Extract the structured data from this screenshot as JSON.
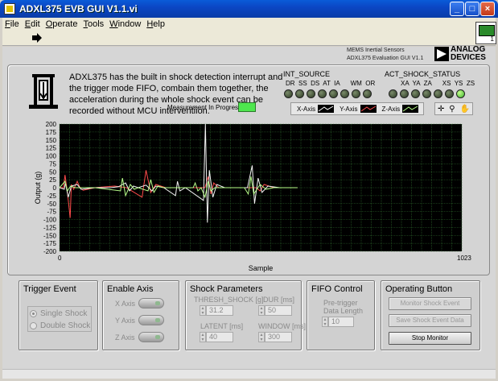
{
  "window": {
    "title": "ADXL375 EVB GUI V1.1.vi"
  },
  "menu": [
    {
      "key": "F",
      "rest": "ile"
    },
    {
      "key": "E",
      "rest": "dit"
    },
    {
      "key": "O",
      "rest": "perate"
    },
    {
      "key": "T",
      "rest": "ools"
    },
    {
      "key": "W",
      "rest": "indow"
    },
    {
      "key": "H",
      "rest": "elp"
    }
  ],
  "toolbar": {
    "vi_icon_label": "1"
  },
  "brand": {
    "line1": "MEMS Inertial Sensors",
    "line2": "ADXL375 Evaluation GUI V1.1",
    "logo_line1": "ANALOG",
    "logo_line2": "DEVICES"
  },
  "description": "ADXL375 has the built in shock detection interrupt and the trigger mode FIFO, combain them together, the acceleration during the whole shock event can be recorded without MCU interventiion.",
  "measurement": {
    "label": "Measurement In Progress",
    "led_color": "#4ee64e"
  },
  "int_source": {
    "title": "INT_SOURCE",
    "labels": "DR  SS  DS  AT  IA      WM  OR",
    "leds": [
      false,
      false,
      false,
      false,
      false,
      false,
      false,
      false
    ]
  },
  "act_shock_status": {
    "title": "ACT_SHOCK_STATUS",
    "labels": "XA  YA  ZA      XS  YS  ZS",
    "leds": [
      false,
      false,
      false,
      false,
      false,
      false,
      true
    ]
  },
  "legend": {
    "x": "X-Axis",
    "y": "Y-Axis",
    "z": "Z-Axis"
  },
  "chart_data": {
    "type": "line",
    "xlabel": "Sample",
    "ylabel": "Output (g)",
    "xlim": [
      0,
      1023
    ],
    "ylim": [
      -200,
      200
    ],
    "x_ticks": [
      "0",
      "1023"
    ],
    "y_ticks": [
      "200",
      "175",
      "150",
      "125",
      "100",
      "75",
      "50",
      "25",
      "0",
      "-25",
      "-50",
      "-75",
      "-100",
      "-125",
      "-150",
      "-175",
      "-200"
    ],
    "grid": true,
    "background": "#000000",
    "grid_color": "#2f6e2f",
    "series": [
      {
        "color": "#ff4a4a",
        "points": [
          [
            0,
            0
          ],
          [
            10,
            0
          ],
          [
            14,
            40
          ],
          [
            20,
            -15
          ],
          [
            27,
            -95
          ],
          [
            30,
            10
          ],
          [
            36,
            -5
          ],
          [
            45,
            20
          ],
          [
            52,
            0
          ],
          [
            60,
            -8
          ],
          [
            90,
            0
          ],
          [
            140,
            5
          ],
          [
            170,
            0
          ],
          [
            210,
            -30
          ],
          [
            220,
            55
          ],
          [
            232,
            -15
          ],
          [
            245,
            10
          ],
          [
            270,
            0
          ],
          [
            370,
            0
          ],
          [
            378,
            35
          ],
          [
            385,
            -20
          ],
          [
            392,
            15
          ],
          [
            405,
            0
          ],
          [
            500,
            0
          ],
          [
            510,
            -10
          ],
          [
            520,
            10
          ],
          [
            545,
            0
          ],
          [
            560,
            0
          ],
          [
            605,
            0
          ]
        ]
      },
      {
        "color": "#f4f4f4",
        "points": [
          [
            0,
            0
          ],
          [
            12,
            -5
          ],
          [
            15,
            15
          ],
          [
            22,
            -30
          ],
          [
            30,
            5
          ],
          [
            45,
            10
          ],
          [
            55,
            -5
          ],
          [
            90,
            0
          ],
          [
            130,
            0
          ],
          [
            150,
            3
          ],
          [
            168,
            15
          ],
          [
            178,
            -10
          ],
          [
            188,
            5
          ],
          [
            200,
            0
          ],
          [
            220,
            8
          ],
          [
            235,
            -10
          ],
          [
            245,
            5
          ],
          [
            265,
            0
          ],
          [
            295,
            -25
          ],
          [
            300,
            20
          ],
          [
            306,
            -10
          ],
          [
            320,
            0
          ],
          [
            366,
            -40
          ],
          [
            371,
            200
          ],
          [
            376,
            -110
          ],
          [
            381,
            55
          ],
          [
            390,
            -30
          ],
          [
            400,
            10
          ],
          [
            420,
            0
          ],
          [
            478,
            0
          ],
          [
            490,
            70
          ],
          [
            496,
            -50
          ],
          [
            505,
            30
          ],
          [
            515,
            -15
          ],
          [
            530,
            5
          ],
          [
            560,
            0
          ],
          [
            605,
            0
          ]
        ]
      },
      {
        "color": "#b8ff8a",
        "points": [
          [
            0,
            0
          ],
          [
            14,
            20
          ],
          [
            20,
            -10
          ],
          [
            28,
            5
          ],
          [
            40,
            0
          ],
          [
            90,
            0
          ],
          [
            155,
            -10
          ],
          [
            160,
            30
          ],
          [
            168,
            -25
          ],
          [
            180,
            10
          ],
          [
            190,
            -5
          ],
          [
            200,
            0
          ],
          [
            225,
            -10
          ],
          [
            232,
            25
          ],
          [
            240,
            -15
          ],
          [
            250,
            5
          ],
          [
            265,
            0
          ],
          [
            340,
            0
          ],
          [
            345,
            15
          ],
          [
            352,
            -10
          ],
          [
            360,
            0
          ],
          [
            370,
            -30
          ],
          [
            378,
            20
          ],
          [
            385,
            -10
          ],
          [
            395,
            0
          ],
          [
            470,
            0
          ],
          [
            480,
            -20
          ],
          [
            487,
            35
          ],
          [
            494,
            -20
          ],
          [
            510,
            10
          ],
          [
            525,
            -5
          ],
          [
            545,
            0
          ],
          [
            605,
            0
          ]
        ]
      }
    ]
  },
  "trigger_event": {
    "title": "Trigger Event",
    "single": "Single Shock",
    "double": "Double Shock"
  },
  "enable_axis": {
    "title": "Enable Axis",
    "x": "X Axis",
    "y": "Y Axis",
    "z": "Z Axis"
  },
  "shock_params": {
    "title": "Shock Parameters",
    "thresh_label": "THRESH_SHOCK [g]",
    "thresh_value": "31.2",
    "dur_label": "DUR [ms]",
    "dur_value": "50",
    "latent_label": "LATENT [ms]",
    "latent_value": "40",
    "window_label": "WINDOW [ms]",
    "window_value": "300"
  },
  "fifo": {
    "title": "FIFO Control",
    "label1": "Pre-trigger",
    "label2": "Data Length",
    "value": "10"
  },
  "operating": {
    "title": "Operating Button",
    "monitor": "Monitor Shock Event",
    "save": "Save Shock Event Data",
    "stop": "Stop Monitor"
  }
}
